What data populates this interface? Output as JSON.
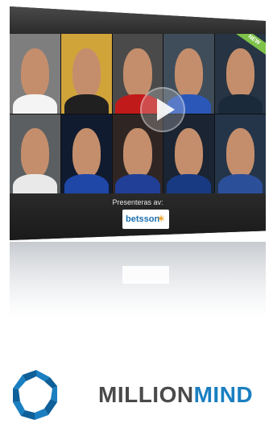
{
  "video_panel": {
    "badge": "NEW",
    "presented_by": "Presenteras av:",
    "sponsor": "betsson",
    "tiles": [
      {
        "bg": "#7e7e7e",
        "shirt": "#f4f4f4"
      },
      {
        "bg": "#d1a43a",
        "shirt": "#202020"
      },
      {
        "bg": "#4a4a4a",
        "shirt": "#c11a1a"
      },
      {
        "bg": "#3f4d5a",
        "shirt": "#2b57b8"
      },
      {
        "bg": "#273443",
        "shirt": "#1b2a3a"
      },
      {
        "bg": "#5b5f62",
        "shirt": "#e9e9e9"
      },
      {
        "bg": "#111b2f",
        "shirt": "#1e47a8"
      },
      {
        "bg": "#2f2624",
        "shirt": "#213f96"
      },
      {
        "bg": "#1b2432",
        "shirt": "#183a83"
      },
      {
        "bg": "#24354a",
        "shirt": "#2c4f9a"
      }
    ]
  },
  "brand": {
    "name_part1": "MILLION",
    "name_part2": "MIND",
    "colors": {
      "primary": "#1a7fc1",
      "dark": "#4a4a4a"
    }
  }
}
